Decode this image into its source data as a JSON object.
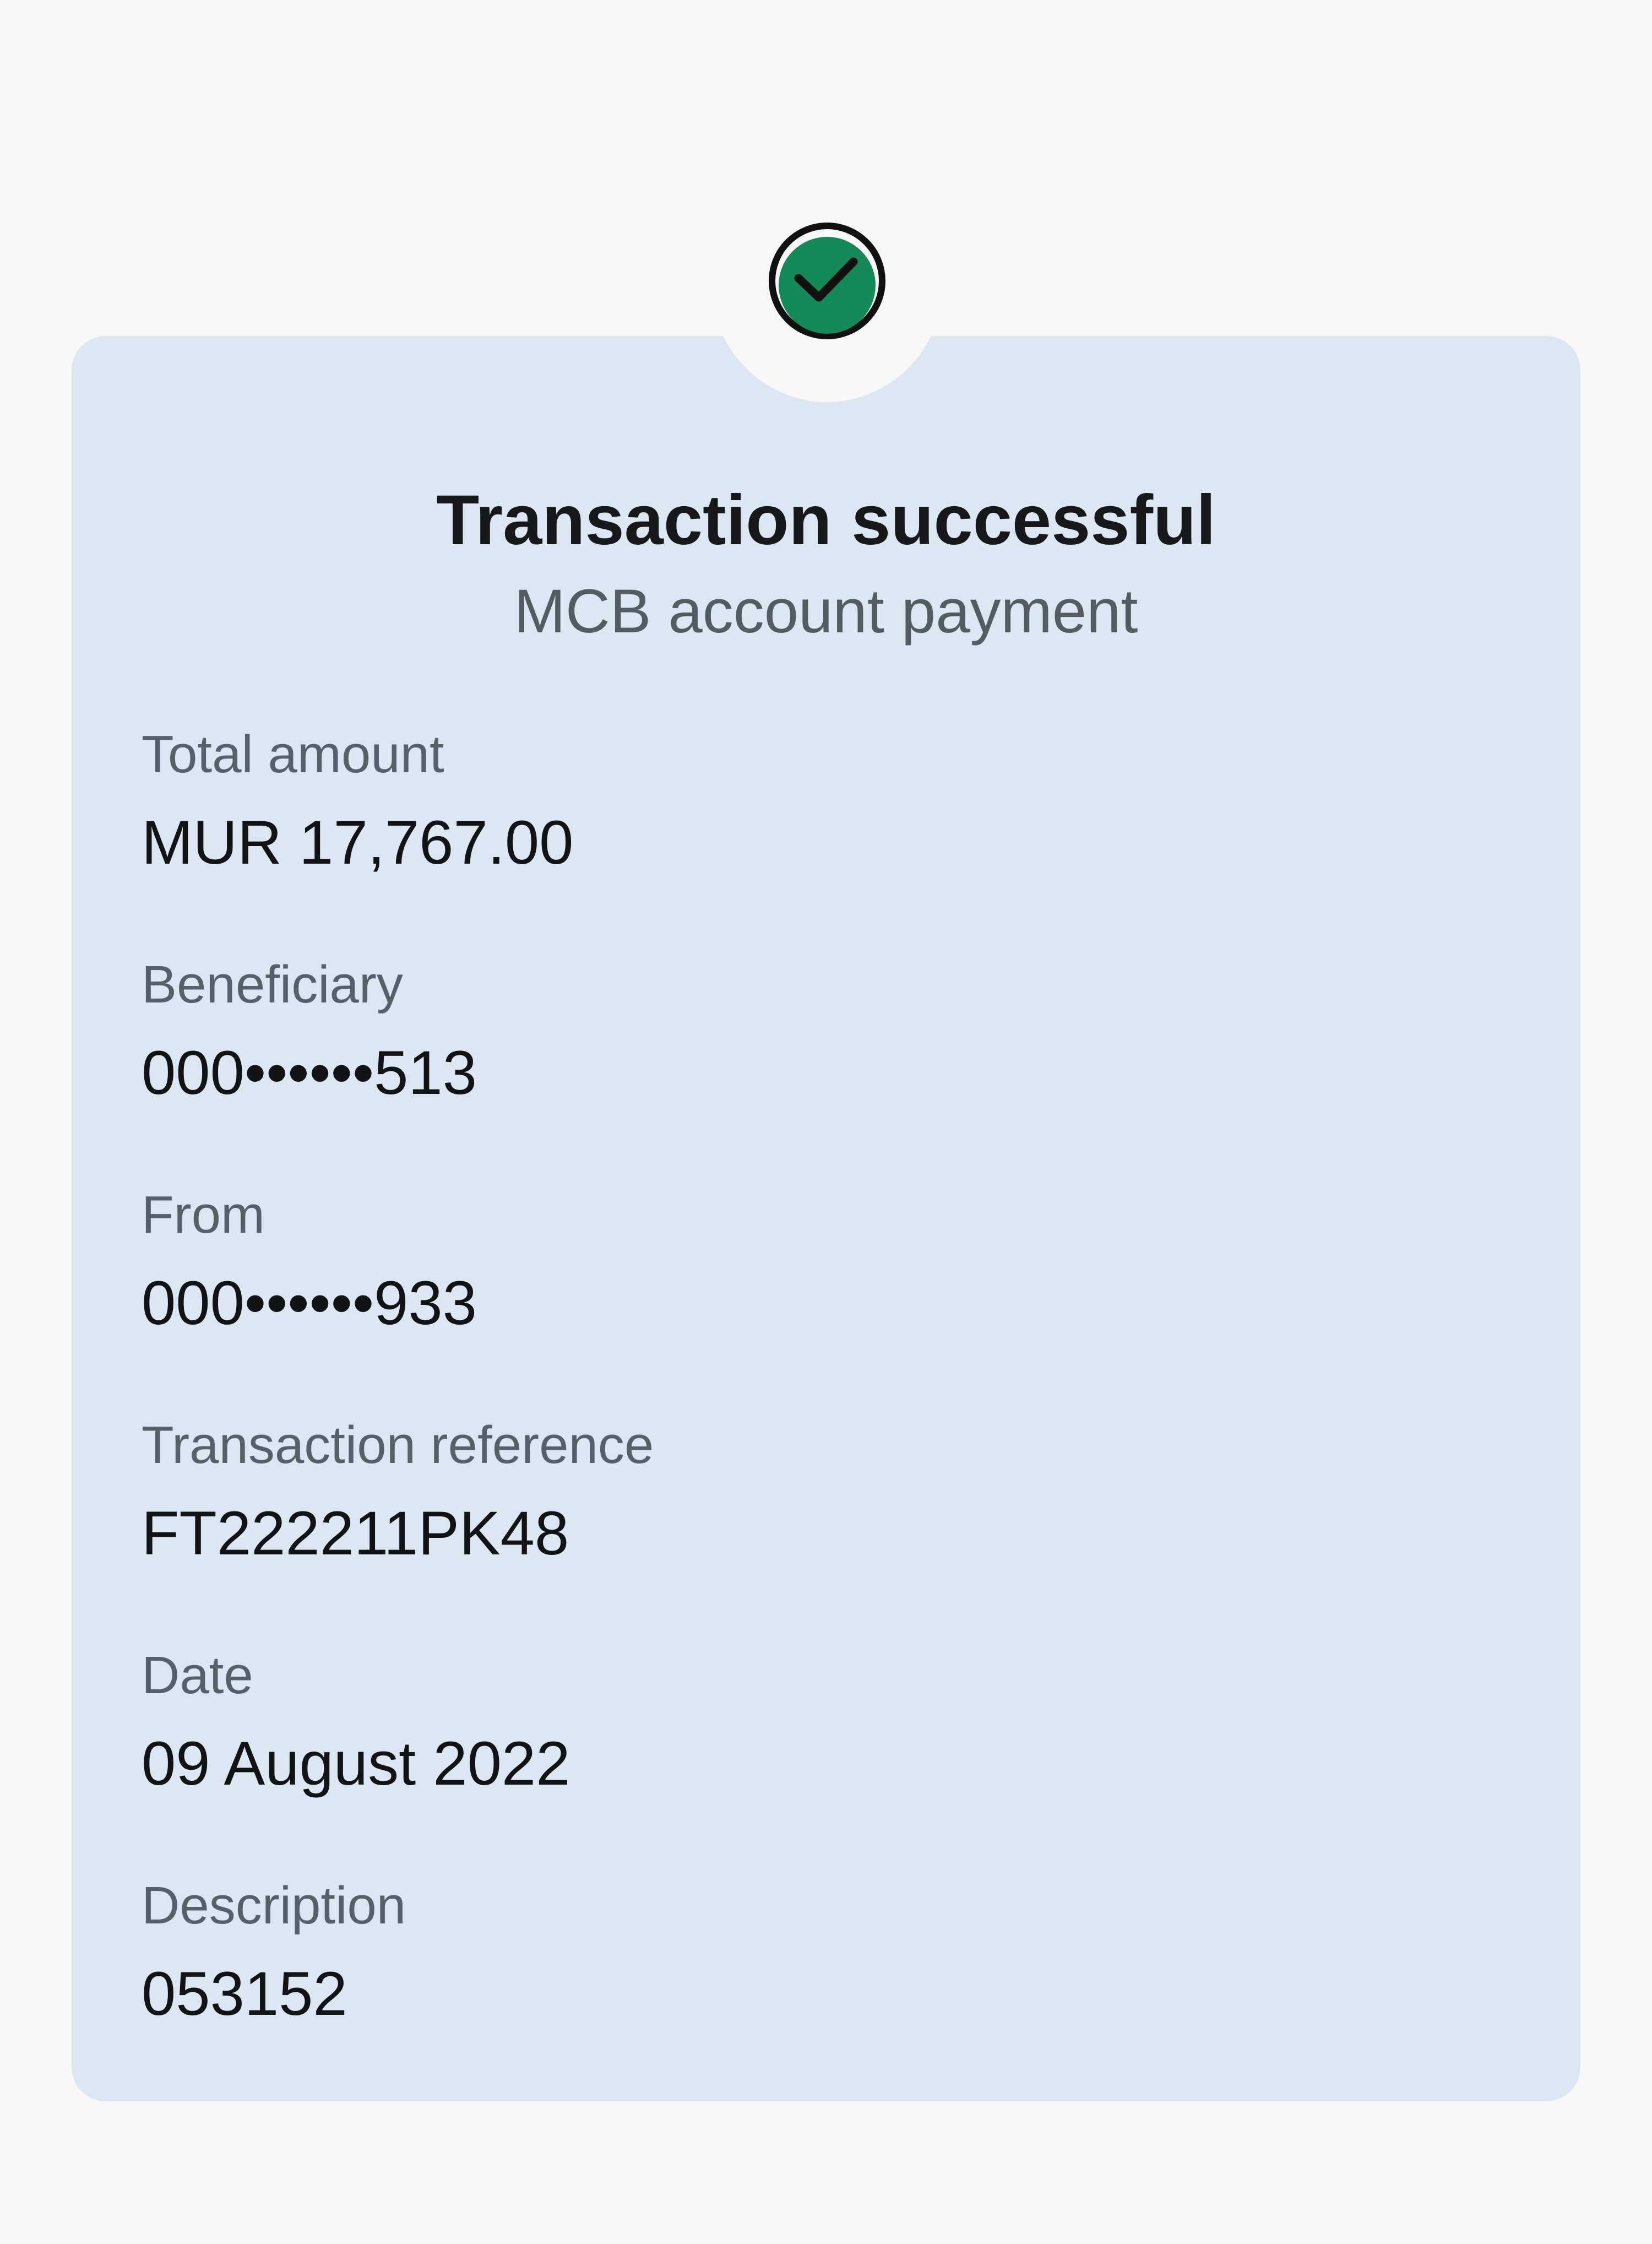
{
  "status": {
    "icon": "checkmark-circle-icon",
    "title": "Transaction successful",
    "subtitle": "MCB account payment"
  },
  "details": [
    {
      "label": "Total amount",
      "value": "MUR 17,767.00"
    },
    {
      "label": "Beneficiary",
      "value": "000••••••513"
    },
    {
      "label": "From",
      "value": "000••••••933"
    },
    {
      "label": "Transaction reference",
      "value": "FT222211PK48"
    },
    {
      "label": "Date",
      "value": "09 August 2022"
    },
    {
      "label": "Description",
      "value": "053152"
    }
  ],
  "colors": {
    "page_background": "#f8f8f8",
    "card_background": "#dde7f3",
    "success_green": "#138a58",
    "title_text": "#17181a",
    "secondary_text": "#535b63"
  }
}
